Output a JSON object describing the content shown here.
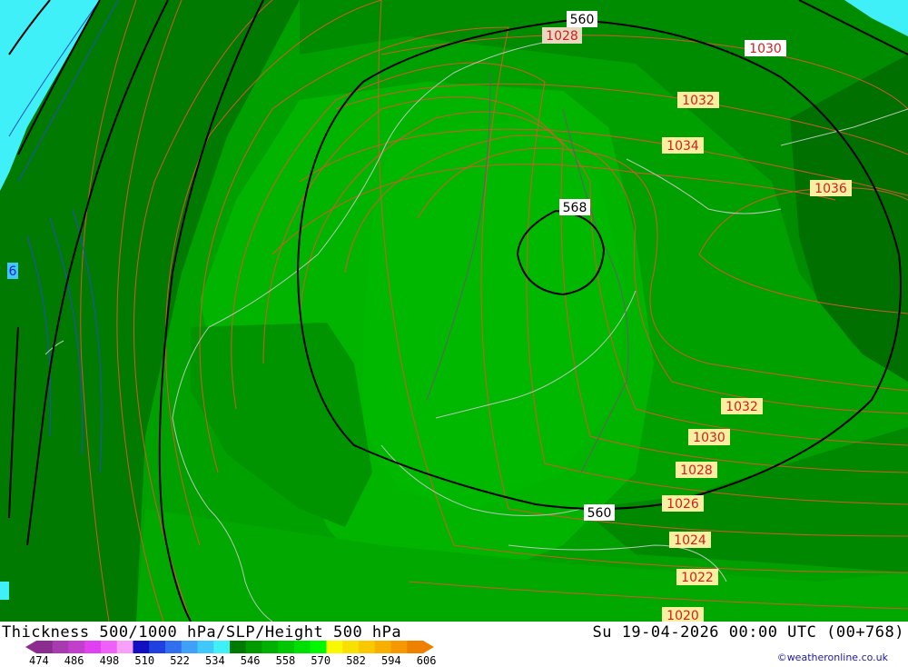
{
  "title": "Thickness 500/1000 hPa/SLP/Height 500 hPa",
  "valid_time": "Su 19-04-2026 00:00 UTC (00+768)",
  "credit": "©weatheronline.co.uk",
  "colorbar": {
    "ticks": [
      "474",
      "486",
      "498",
      "510",
      "522",
      "534",
      "546",
      "558",
      "570",
      "582",
      "594",
      "606"
    ],
    "colors": [
      "#8a2d8f",
      "#a83bb0",
      "#c23fcc",
      "#e040f0",
      "#f060f8",
      "#f8a0f8",
      "#1010c0",
      "#2040e0",
      "#3070f0",
      "#40a0f8",
      "#40c8f8",
      "#40f0f8",
      "#007a00",
      "#009a00",
      "#00b000",
      "#00c800",
      "#00e000",
      "#00f800",
      "#f8f800",
      "#f8e000",
      "#f8c800",
      "#f8b000",
      "#f89800",
      "#f08000"
    ]
  },
  "map": {
    "height500_labels": [
      {
        "text": "560"
      },
      {
        "text": "568"
      },
      {
        "text": "560"
      }
    ],
    "slp_labels": [
      {
        "text": "1028"
      },
      {
        "text": "1030"
      },
      {
        "text": "1032"
      },
      {
        "text": "1034"
      },
      {
        "text": "1036"
      },
      {
        "text": "1032"
      },
      {
        "text": "1030"
      },
      {
        "text": "1028"
      },
      {
        "text": "1026"
      },
      {
        "text": "1024"
      },
      {
        "text": "1022"
      },
      {
        "text": "1020"
      }
    ],
    "thickness_labels": [
      {
        "text": "6"
      }
    ]
  }
}
